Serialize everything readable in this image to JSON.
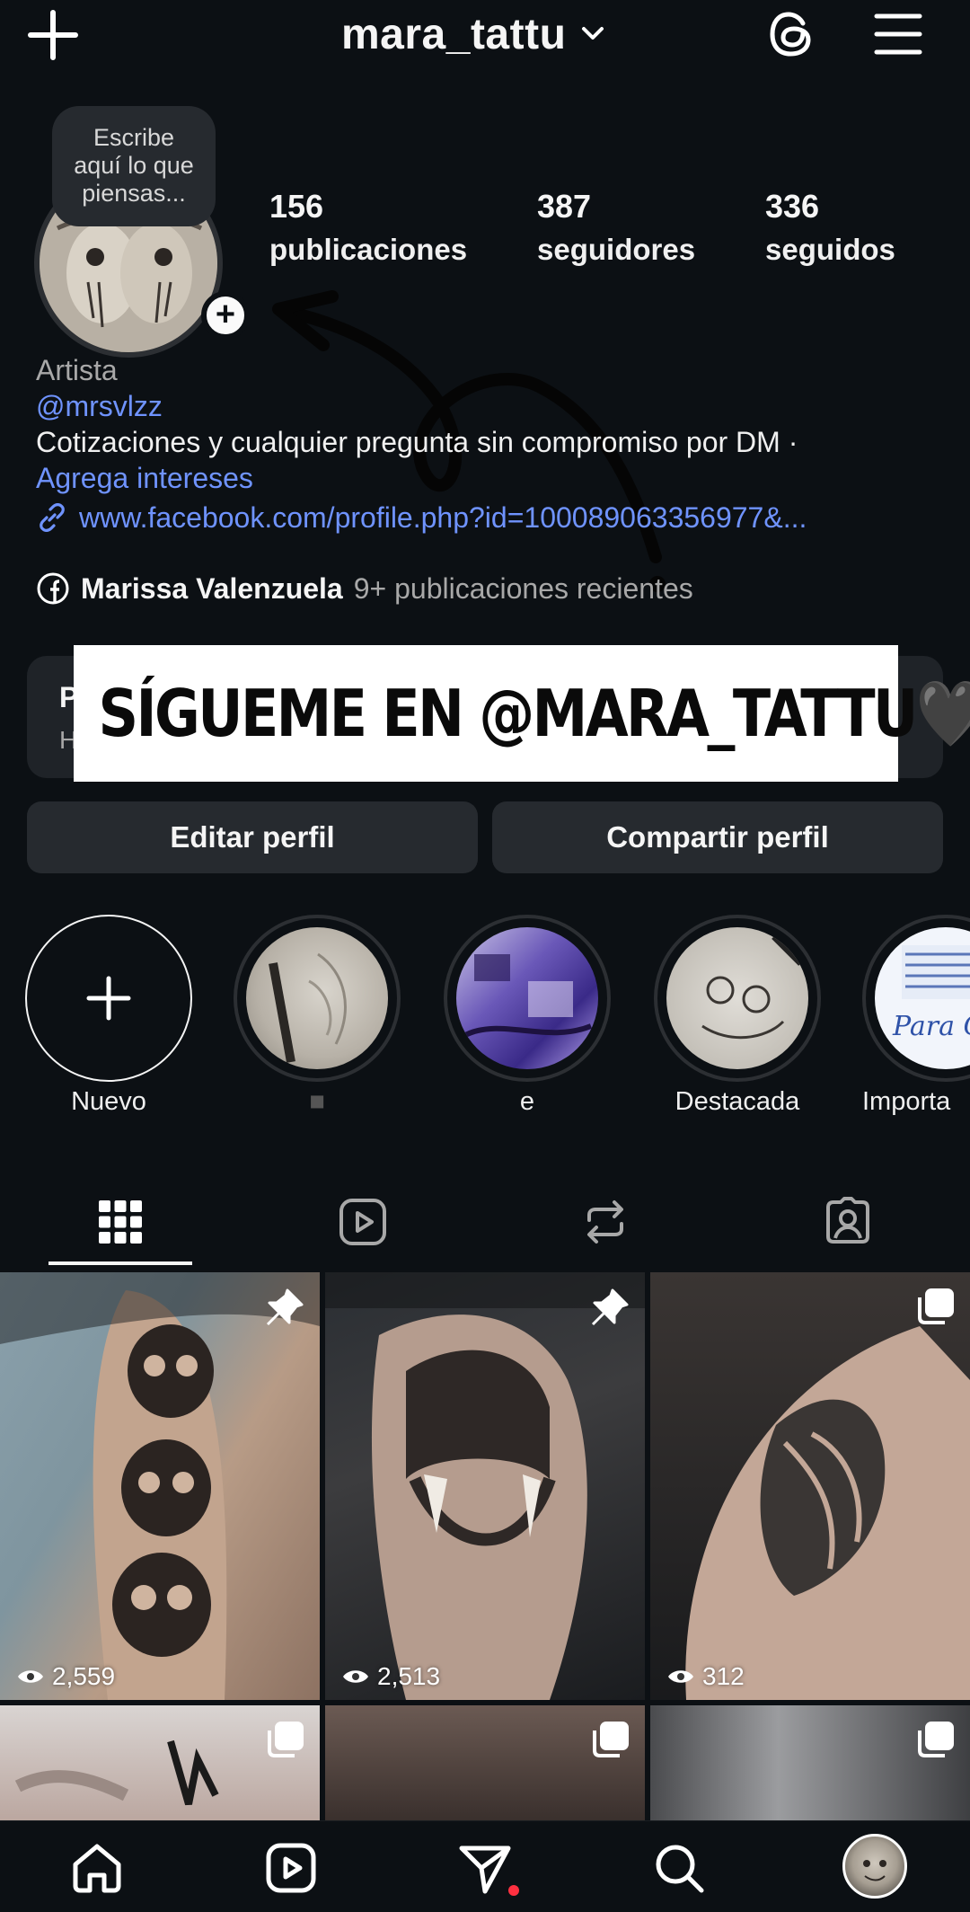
{
  "header": {
    "username": "mara_tattu",
    "icons": [
      "plus-icon",
      "chevron-down-icon",
      "threads-icon",
      "hamburger-menu-icon"
    ]
  },
  "profile": {
    "note": [
      "Escribe",
      "aquí lo que",
      "piensas..."
    ],
    "stats": [
      {
        "value": "156",
        "label": "publicaciones"
      },
      {
        "value": "387",
        "label": "seguidores"
      },
      {
        "value": "336",
        "label": "seguidos"
      }
    ],
    "category": "Artista",
    "threads_handle": "@mrsvlzz",
    "description": "Cotizaciones y cualquier pregunta sin compromiso por DM ·",
    "interests": "Agrega intereses",
    "link": "www.facebook.com/profile.php?id=100089063356977&...",
    "facebook": {
      "name": "Marissa Valenzuela",
      "recent": "9+ publicaciones recientes"
    }
  },
  "dashboard": {
    "title": "P",
    "subtitle": "H"
  },
  "banner": {
    "text": "SÍGUEME EN @MARA_TATTU🖤"
  },
  "actions": {
    "edit": "Editar perfil",
    "share": "Compartir perfil"
  },
  "highlights": [
    {
      "label": "Nuevo"
    },
    {
      "label": "■"
    },
    {
      "label": "e"
    },
    {
      "label": "Destacada"
    },
    {
      "label": "Importa"
    }
  ],
  "tabs": [
    "grid-icon",
    "reels-icon",
    "reposts-icon",
    "tagged-icon"
  ],
  "posts": [
    {
      "views": "2,559",
      "badge": "pin-icon"
    },
    {
      "views": "2,513",
      "badge": "pin-icon"
    },
    {
      "views": "312",
      "badge": "carousel-icon"
    },
    {
      "views": "",
      "badge": "carousel-icon"
    },
    {
      "views": "",
      "badge": "carousel-icon"
    },
    {
      "views": "",
      "badge": "carousel-icon"
    }
  ],
  "bottom_nav": [
    "home-icon",
    "reels-icon",
    "direct-messages-icon",
    "search-icon",
    "profile-avatar"
  ],
  "colors": {
    "background": "#0c1014",
    "link": "#6f93ff",
    "button": "#262a2f",
    "notification": "#ff3040"
  }
}
